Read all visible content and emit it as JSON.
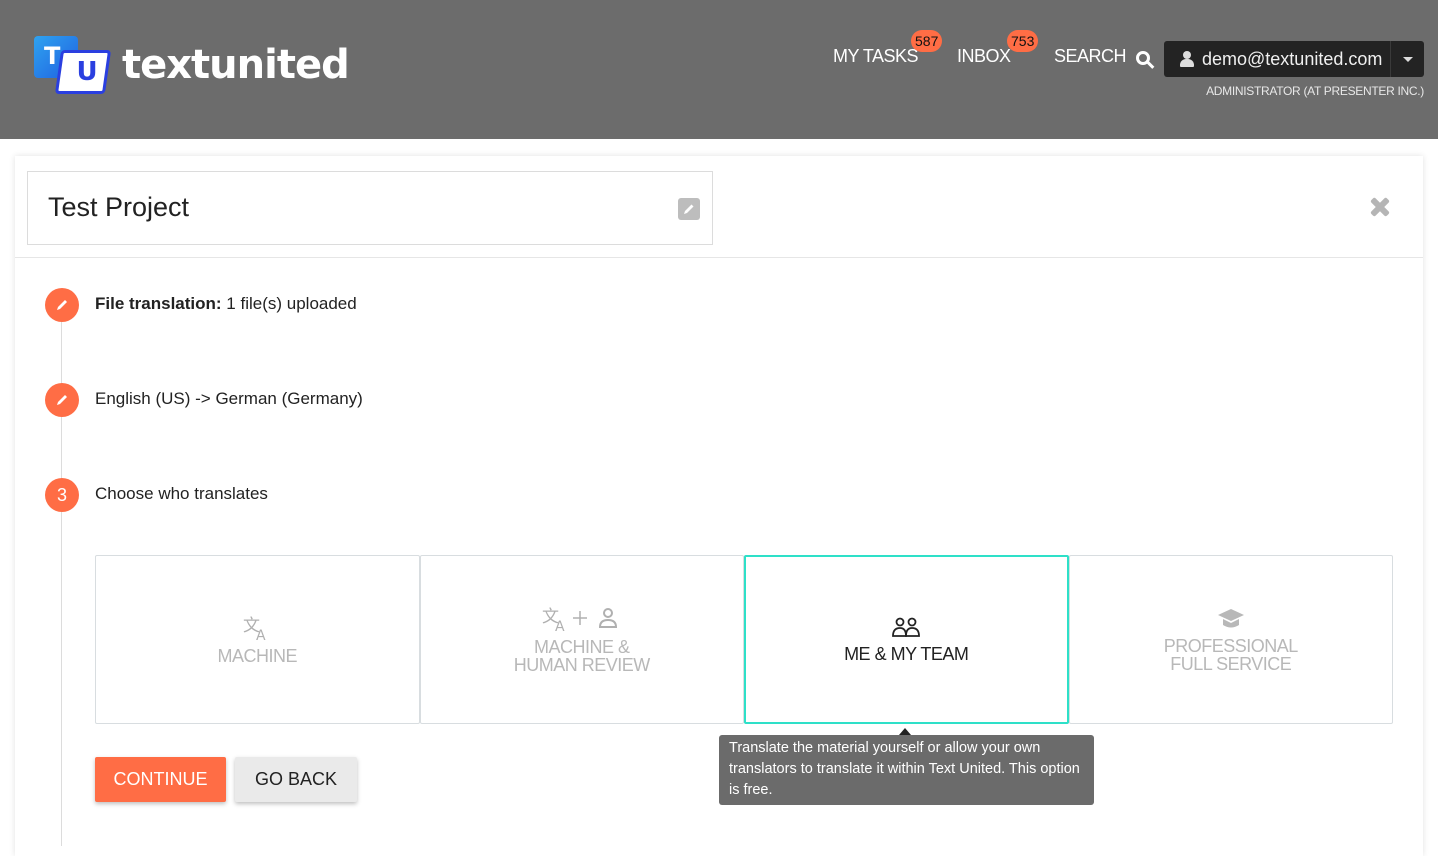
{
  "header": {
    "logo_text": "textunited",
    "logo_letters": {
      "t": "T",
      "u": "U"
    },
    "nav": [
      {
        "label": "MY TASKS",
        "badge": "587"
      },
      {
        "label": "INBOX",
        "badge": "753"
      },
      {
        "label": "SEARCH",
        "icon": "search-icon"
      }
    ],
    "user": {
      "email": "demo@textunited.com",
      "role": "ADMINISTRATOR (AT PRESENTER INC.)"
    }
  },
  "project": {
    "title": "Test Project"
  },
  "steps": [
    {
      "number": "",
      "icon": "pencil-icon",
      "label_bold": "File translation:",
      "label": " 1 file(s) uploaded"
    },
    {
      "number": "",
      "icon": "pencil-icon",
      "label_bold": "",
      "label": "English (US) -> German (Germany)"
    },
    {
      "number": "3",
      "icon": "",
      "label_bold": "",
      "label": "Choose who translates"
    }
  ],
  "options": [
    {
      "label_line1": "MACHINE",
      "label_line2": "",
      "icon": "translate-icon",
      "selected": false
    },
    {
      "label_line1": "MACHINE &",
      "label_line2": "HUMAN REVIEW",
      "icon": "translate-plus-person-icon",
      "selected": false
    },
    {
      "label_line1": "ME & MY TEAM",
      "label_line2": "",
      "icon": "team-icon",
      "selected": true
    },
    {
      "label_line1": "PROFESSIONAL",
      "label_line2": "FULL SERVICE",
      "icon": "graduation-cap-icon",
      "selected": false
    }
  ],
  "buttons": {
    "continue": "CONTINUE",
    "go_back": "GO BACK"
  },
  "tooltip": {
    "text": "Translate the material yourself or allow your own translators to translate it within Text United. This option is free."
  },
  "colors": {
    "accent": "#ff6d45",
    "selected_border": "#2ee0c8",
    "header_bg": "#6c6c6c"
  }
}
